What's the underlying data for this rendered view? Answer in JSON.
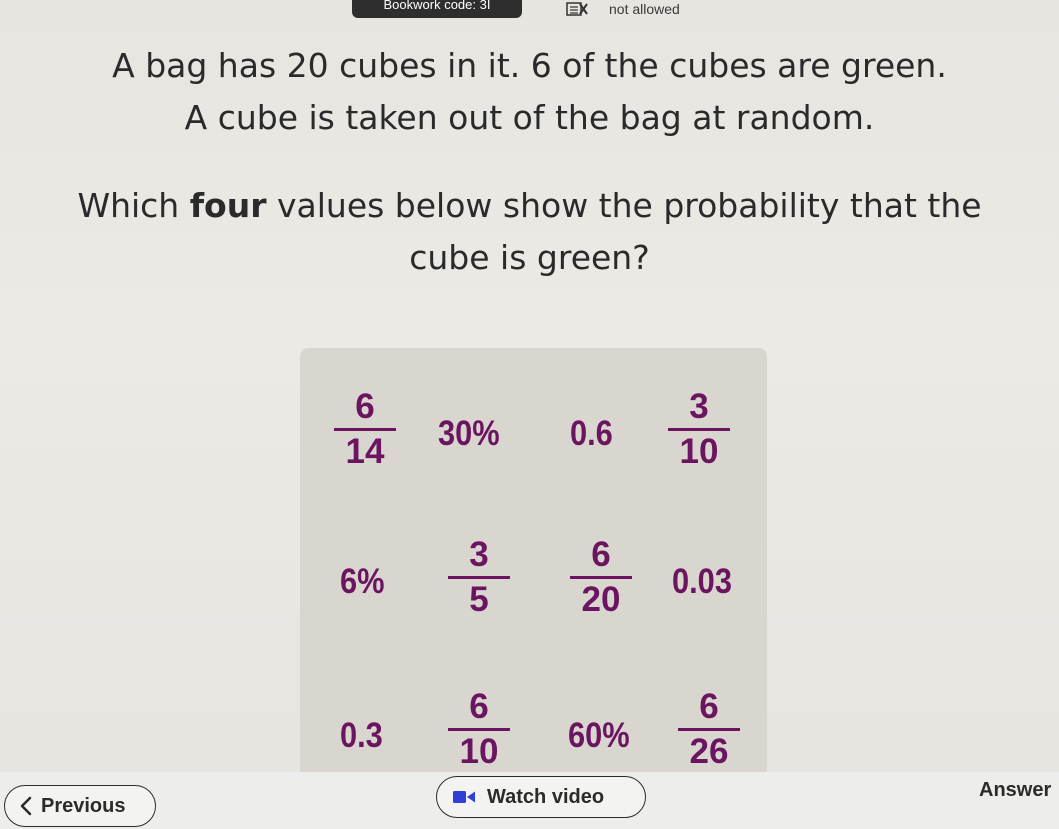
{
  "header": {
    "bookwork_code_label": "Bookwork code: 3I",
    "calculator_status": "not allowed",
    "calculator_icon": "calculator-crossed-icon"
  },
  "question": {
    "line1": "A bag has 20 cubes in it. 6 of the cubes are green.",
    "line2": "A cube is taken out of the bag at random.",
    "line3_pre": "Which ",
    "line3_bold": "four",
    "line3_post": " values below show the probability that the",
    "line4": "cube is green?"
  },
  "options": {
    "r1c1": {
      "num": "6",
      "den": "14"
    },
    "r1c2": "30%",
    "r1c3": "0.6",
    "r1c4": {
      "num": "3",
      "den": "10"
    },
    "r2c1": "6%",
    "r2c2": {
      "num": "3",
      "den": "5"
    },
    "r2c3": {
      "num": "6",
      "den": "20"
    },
    "r2c4": "0.03",
    "r3c1": "0.3",
    "r3c2": {
      "num": "6",
      "den": "10"
    },
    "r3c3": "60%",
    "r3c4": {
      "num": "6",
      "den": "26"
    }
  },
  "colors": {
    "option_text": "#6b1561",
    "card_background": "#d9d5cf"
  },
  "footer": {
    "previous_label": "Previous",
    "watch_video_label": "Watch video",
    "answer_label": "Answer"
  }
}
